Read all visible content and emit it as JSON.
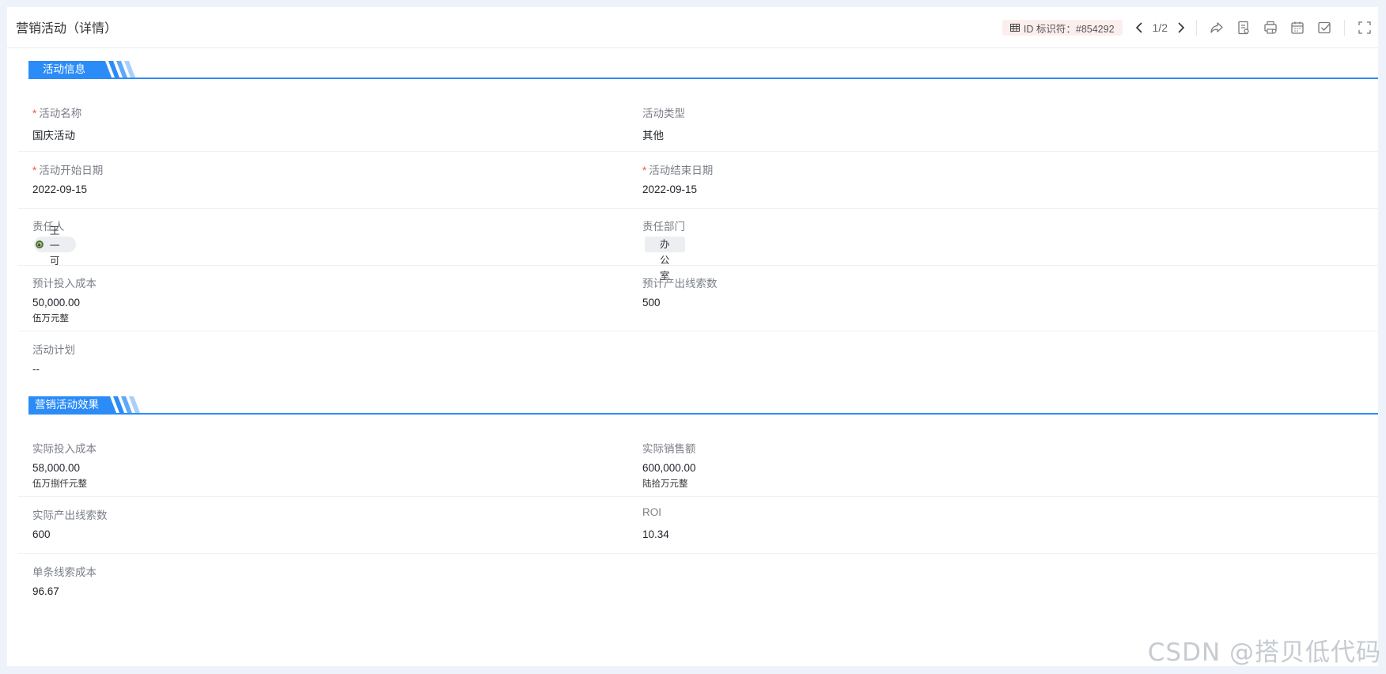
{
  "page": {
    "title": "营销活动（详情）"
  },
  "toolbar": {
    "id_chip": "ID 标识符：#854292",
    "pager": "1/2",
    "icons": [
      "share-icon",
      "document-icon",
      "print-icon",
      "calendar-icon",
      "checkbox-icon",
      "fullscreen-icon"
    ]
  },
  "sections": {
    "info": {
      "title": "活动信息",
      "name_label": "活动名称",
      "name_value": "国庆活动",
      "type_label": "活动类型",
      "type_value": "其他",
      "start_label": "活动开始日期",
      "start_value": "2022-09-15",
      "end_label": "活动结束日期",
      "end_value": "2022-09-15",
      "owner_label": "责任人",
      "owner_value": "王一可",
      "dept_label": "责任部门",
      "dept_value": "办公室",
      "est_cost_label": "预计投入成本",
      "est_cost_value": "50,000.00",
      "est_cost_caps": "伍万元整",
      "est_leads_label": "预计产出线索数",
      "est_leads_value": "500",
      "plan_label": "活动计划",
      "plan_value": "--"
    },
    "effect": {
      "title": "营销活动效果",
      "act_cost_label": "实际投入成本",
      "act_cost_value": "58,000.00",
      "act_cost_caps": "伍万捌仟元整",
      "sales_label": "实际销售额",
      "sales_value": "600,000.00",
      "sales_caps": "陆拾万元整",
      "act_leads_label": "实际产出线索数",
      "act_leads_value": "600",
      "roi_label": "ROI",
      "roi_value": "10.34",
      "lead_cost_label": "单条线索成本",
      "lead_cost_value": "96.67"
    }
  },
  "required_mark": "*",
  "watermark": "CSDN @搭贝低代码",
  "colors": {
    "accent": "#2b8cf7",
    "required": "#f05a3c",
    "chip_bg": "#fdeeee"
  }
}
